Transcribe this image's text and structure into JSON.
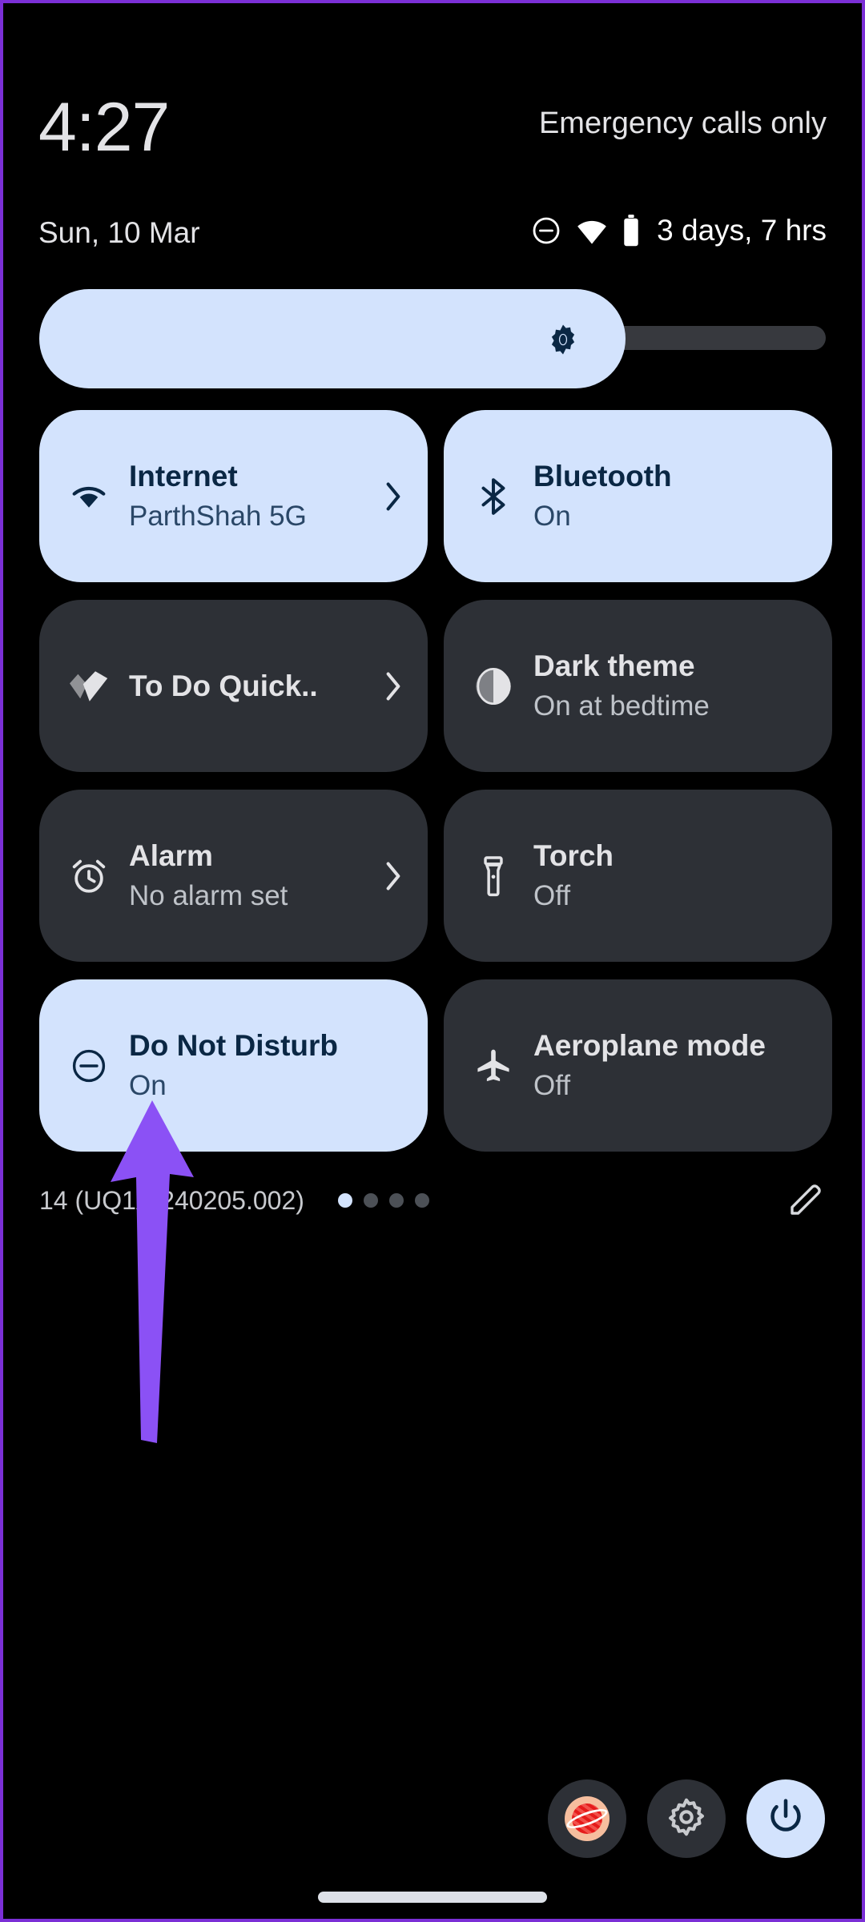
{
  "meta": {
    "accent_active_bg": "#D3E3FD",
    "accent_active_fg": "#0A2744",
    "tile_bg": "#2D3036",
    "screen_bg": "#000000",
    "annotation_color": "#8B51F5"
  },
  "status_header": {
    "clock": "4:27",
    "carrier": "Emergency calls only",
    "date": "Sun, 10 Mar",
    "icons": [
      "do-not-disturb-icon",
      "wifi-icon",
      "battery-icon"
    ],
    "battery_text": "3 days, 7 hrs"
  },
  "brightness": {
    "label": "Brightness",
    "icon": "brightness-icon",
    "level_percent": 75
  },
  "tiles": [
    {
      "label": "Internet",
      "sub": "ParthShah 5G",
      "icon": "wifi-icon",
      "active": true,
      "chevron": true
    },
    {
      "label": "Bluetooth",
      "sub": "On",
      "icon": "bluetooth-icon",
      "active": true,
      "chevron": false
    },
    {
      "label": "To Do Quick..",
      "sub": "",
      "icon": "todo-check-icon",
      "active": false,
      "chevron": true
    },
    {
      "label": "Dark theme",
      "sub": "On at bedtime",
      "icon": "dark-theme-icon",
      "active": false,
      "chevron": false
    },
    {
      "label": "Alarm",
      "sub": "No alarm set",
      "icon": "alarm-icon",
      "active": false,
      "chevron": true
    },
    {
      "label": "Torch",
      "sub": "Off",
      "icon": "torch-icon",
      "active": false,
      "chevron": false
    },
    {
      "label": "Do Not Disturb",
      "sub": "On",
      "icon": "do-not-disturb-icon",
      "active": true,
      "chevron": false
    },
    {
      "label": "Aeroplane mode",
      "sub": "Off",
      "icon": "aeroplane-icon",
      "active": false,
      "chevron": false
    }
  ],
  "footer": {
    "build": "14 (UQ1A.240205.002)",
    "pages": 4,
    "current_page": 1,
    "edit_icon": "pencil-icon"
  },
  "bottom_actions": [
    {
      "name": "user-avatar-button",
      "icon": "planet-avatar-icon"
    },
    {
      "name": "settings-button",
      "icon": "gear-icon"
    },
    {
      "name": "power-button",
      "icon": "power-icon"
    }
  ]
}
